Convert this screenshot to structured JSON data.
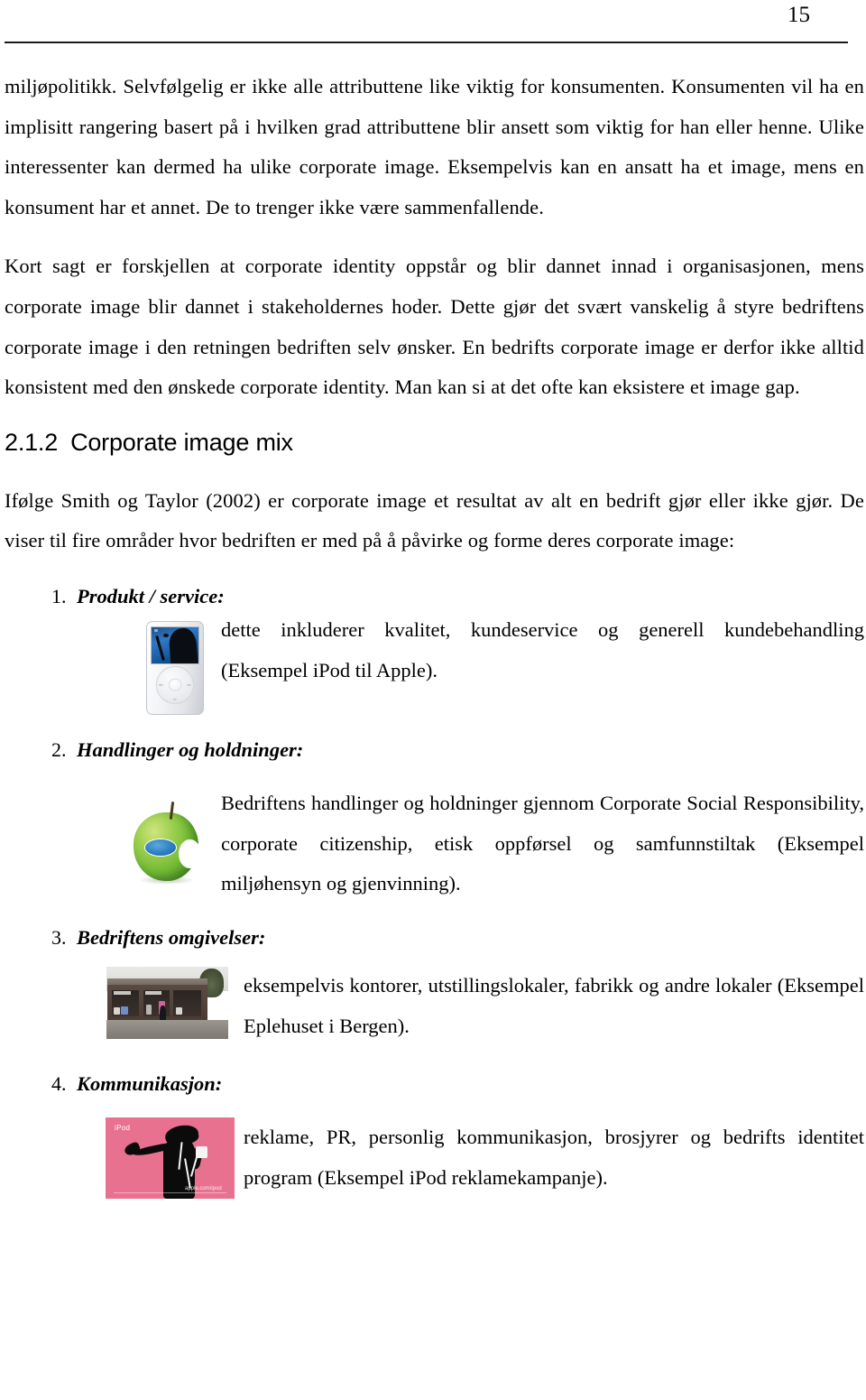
{
  "header": {
    "page_number": "15"
  },
  "body": {
    "paragraphs": [
      "miljøpolitikk. Selvfølgelig er ikke alle attributtene like viktig for konsumenten. Konsumenten vil ha en implisitt rangering basert på i hvilken grad attributtene blir ansett som viktig for han eller henne. Ulike interessenter kan dermed ha ulike corporate image. Eksempelvis kan en ansatt ha et image, mens en konsument har et annet. De to trenger ikke være sammenfallende.",
      "Kort sagt er forskjellen at corporate identity oppstår og blir dannet innad i organisasjonen, mens corporate image blir dannet i stakeholdernes hoder. Dette gjør det svært vanskelig å styre bedriftens corporate image i den retningen bedriften selv ønsker. En bedrifts corporate image er derfor ikke alltid konsistent med den ønskede corporate identity. Man kan si at det ofte kan eksistere et image gap."
    ]
  },
  "heading": {
    "number": "2.1.2",
    "title": "Corporate image mix"
  },
  "intro": {
    "text": "Ifølge Smith og Taylor (2002) er corporate image et resultat av alt en bedrift gjør eller ikke gjør. De viser til fire områder hvor bedriften er med på å påvirke og forme deres corporate image:"
  },
  "areas": [
    {
      "marker": "1.",
      "title": "Produkt / service:",
      "description": "dette inkluderer kvalitet, kundeservice og generell kundebehandling (Eksempel iPod til Apple).",
      "figure": "ipod-classic-photo"
    },
    {
      "marker": "2.",
      "title": "Handlinger og holdninger:",
      "description": "Bedriftens handlinger og holdninger gjennom Corporate Social Responsibility, corporate citizenship, etisk oppførsel og samfunnstiltak (Eksempel miljøhensyn og gjenvinning).",
      "figure": "green-apple-photo"
    },
    {
      "marker": "3.",
      "title": "Bedriftens omgivelser:",
      "description": "eksempelvis kontorer, utstillingslokaler, fabrikk og andre lokaler (Eksempel Eplehuset i Bergen).",
      "figure": "storefront-photo"
    },
    {
      "marker": "4.",
      "title": "Kommunikasjon:",
      "description": "reklame, PR, personlig kommunikasjon, brosjyrer og bedrifts identitet program (Eksempel iPod reklamekampanje).",
      "figure": "ipod-advert-photo"
    }
  ],
  "figures": {
    "ipod_advert": {
      "brand_label": "iPod",
      "footer_text": "apple.com/ipod"
    }
  },
  "colors": {
    "text": "#000000",
    "rule": "#1a1a1a",
    "advert_pink": "#e8718f",
    "apple_green": "#6db832",
    "sticker_blue": "#2d7fc0"
  }
}
